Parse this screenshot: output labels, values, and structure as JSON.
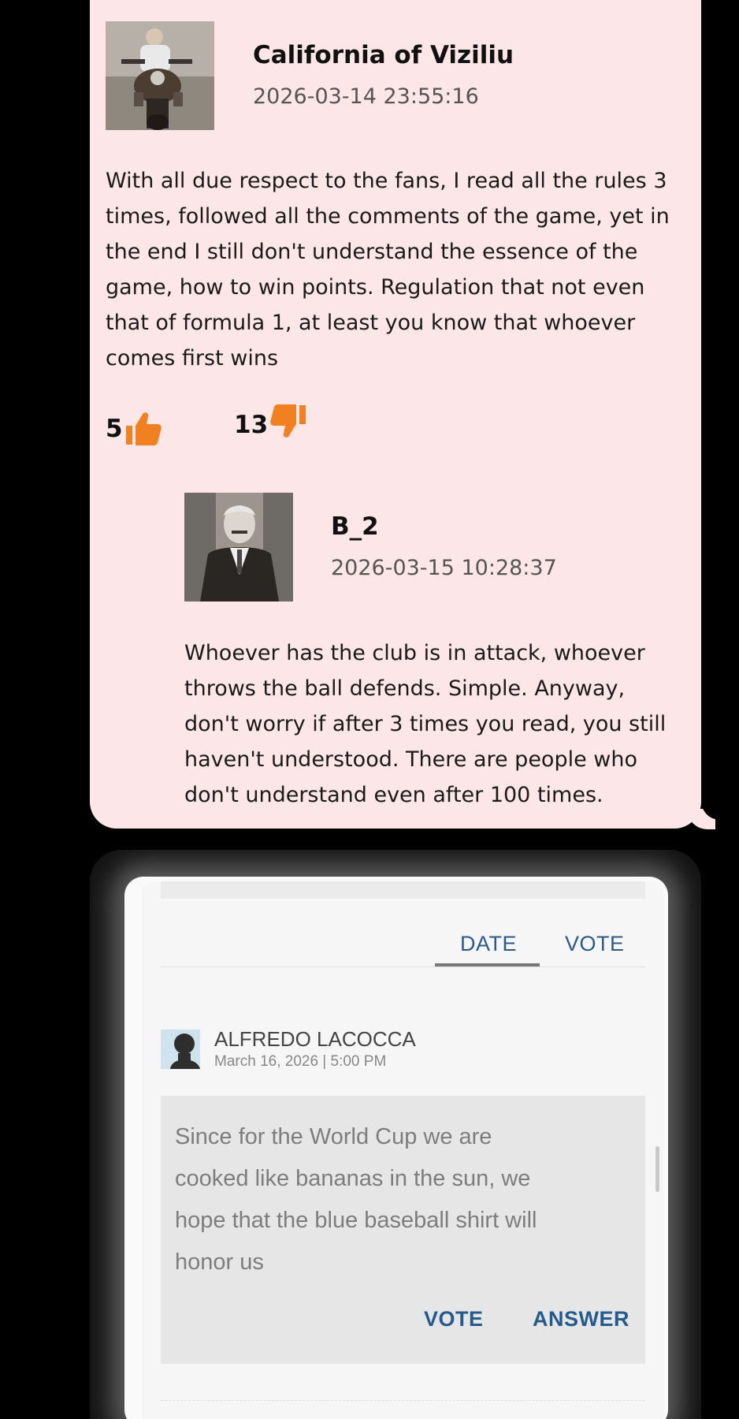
{
  "comment_thread": {
    "top_comment": {
      "author": "California of Viziliu",
      "timestamp": "2026-03-14 23:55:16",
      "lines": [
        "With all due respect to the fans, I read all the rules 3",
        "times, followed all the comments of the game, yet in",
        "the end I still don't understand the essence of the",
        "game, how to win points. Regulation that not even",
        "that of formula 1, at least you know that whoever",
        "comes first wins"
      ],
      "likes": "5",
      "dislikes": "13"
    },
    "reply": {
      "author": "B_2",
      "timestamp": "2026-03-15 10:28:37",
      "lines": [
        "Whoever has the club is in attack, whoever",
        "throws the ball defends. Simple. Anyway,",
        "don't worry if after 3 times you read, you still",
        "haven't understood. There are people who",
        "don't understand even after 100 times."
      ]
    },
    "vote_color": "#f08020"
  },
  "news_comments": {
    "tabs": [
      {
        "label": "DATE",
        "active": true
      },
      {
        "label": "VOTE",
        "active": false
      }
    ],
    "comment": {
      "author": "ALFREDO LACOCCA",
      "date": "March 16, 2026 | 5:00 PM",
      "lines": [
        "Since for the World Cup we are",
        "cooked like bananas in the sun, we",
        "hope that the blue baseball shirt will",
        "honor us"
      ],
      "actions": {
        "vote": "VOTE",
        "answer": "ANSWER"
      }
    },
    "link_color": "#255b8c"
  }
}
